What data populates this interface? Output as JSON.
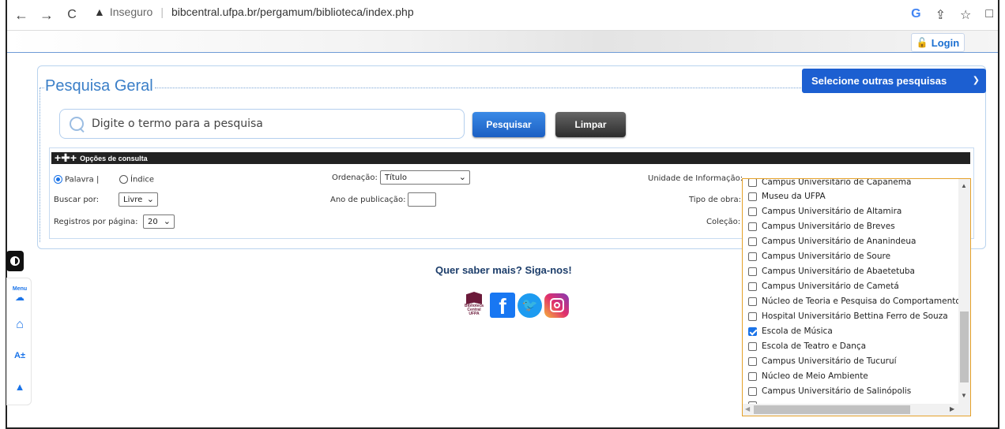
{
  "browser": {
    "nav_back": "←",
    "nav_forward": "→",
    "reload": "C",
    "warning_icon": "warning-icon",
    "insecure_label": "Inseguro",
    "url": "bibcentral.ufpa.br/pergamum/biblioteca/index.php",
    "google_icon": "G",
    "share_icon": "⇪",
    "star_icon": "☆",
    "panel_icon": "□"
  },
  "header": {
    "login_label": "Login"
  },
  "search": {
    "title": "Pesquisa Geral",
    "other_searches": "Selecione outras pesquisas",
    "placeholder": "Digite o termo para a pesquisa",
    "search_button": "Pesquisar",
    "clear_button": "Limpar"
  },
  "options": {
    "bar_label": "Opções de consulta",
    "radio_palavra": "Palavra |",
    "radio_indice": "Índice",
    "selected_radio": "Palavra",
    "ordenacao_label": "Ordenação:",
    "ordenacao_value": "Título",
    "unidade_label": "Unidade de Informação:",
    "buscar_por_label": "Buscar por:",
    "buscar_por_value": "Livre",
    "ano_label": "Ano de publicação:",
    "ano_value": "",
    "tipo_obra_label": "Tipo de obra:",
    "registros_label": "Registros por página:",
    "registros_value": "20",
    "colecao_label": "Coleção:"
  },
  "unidades": [
    {
      "label": "Campus Universitário de Capanema",
      "checked": false
    },
    {
      "label": "Museu da UFPA",
      "checked": false
    },
    {
      "label": "Campus Universitário de Altamira",
      "checked": false
    },
    {
      "label": "Campus Universitário de Breves",
      "checked": false
    },
    {
      "label": "Campus Universitário de Ananindeua",
      "checked": false
    },
    {
      "label": "Campus Universitário de Soure",
      "checked": false
    },
    {
      "label": "Campus Universitário de Abaetetuba",
      "checked": false
    },
    {
      "label": "Campus Universitário de Cametá",
      "checked": false
    },
    {
      "label": "Núcleo de Teoria e Pesquisa do Comportamento",
      "checked": false
    },
    {
      "label": "Hospital Universitário Bettina Ferro de Souza",
      "checked": false
    },
    {
      "label": "Escola de Música",
      "checked": true
    },
    {
      "label": "Escola de Teatro e Dança",
      "checked": false
    },
    {
      "label": "Campus Universitário de Tucuruí",
      "checked": false
    },
    {
      "label": "Núcleo de Meio Ambiente",
      "checked": false
    },
    {
      "label": "Campus Universitário de Salinópolis",
      "checked": false
    }
  ],
  "footer": {
    "follow_text": "Quer saber mais? Siga-nos!",
    "biblioteca_logo_text": "Biblioteca Central UFPA",
    "social_icons": [
      "biblioteca-icon",
      "facebook-icon",
      "twitter-icon",
      "instagram-icon"
    ]
  },
  "accessibility": {
    "menu_label": "Menu",
    "font_label": "A±",
    "items": [
      "contrast-icon",
      "menu-icon",
      "home-icon",
      "font-size-icon",
      "scroll-top-icon"
    ]
  },
  "colors": {
    "accent": "#1c5fd1",
    "title": "#3b7fc8",
    "highlight_border": "#e5a12a"
  }
}
